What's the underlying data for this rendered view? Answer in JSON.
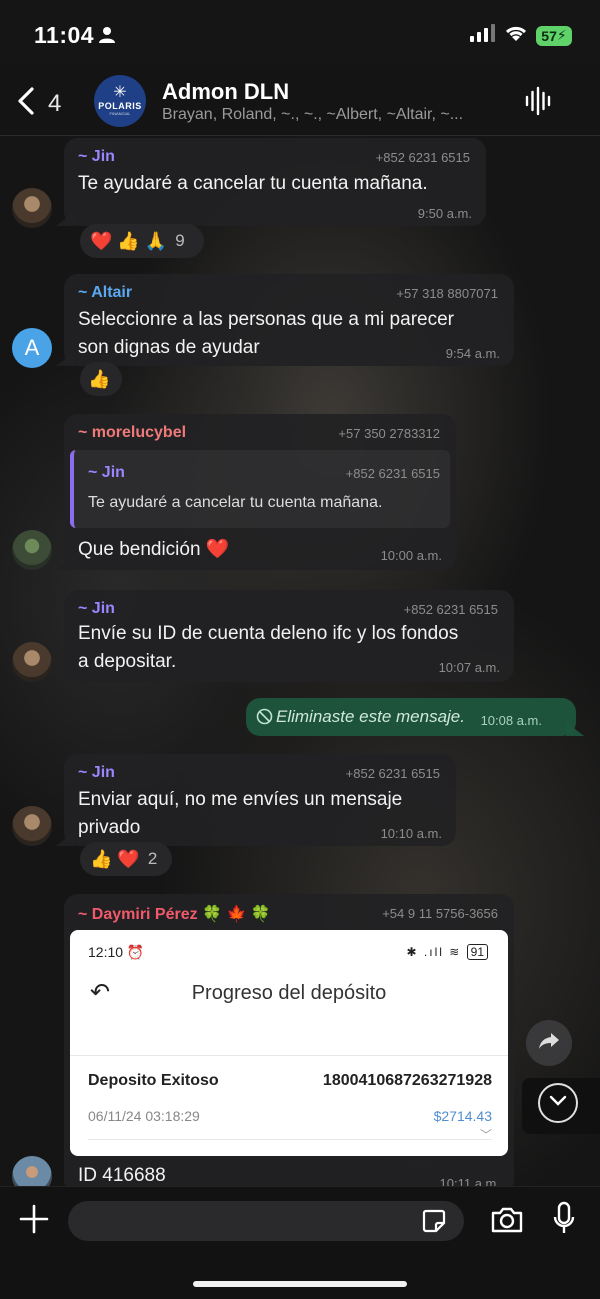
{
  "status": {
    "time": "11:04",
    "battery": "57"
  },
  "header": {
    "back_count": "4",
    "avatar_brand": "POLARIS",
    "avatar_brand_sub": "FINANCIAL",
    "title": "Admon DLN",
    "members": "Brayan, Roland, ~., ~., ~Albert, ~Altair, ~..."
  },
  "messages": [
    {
      "sender": "~ Jin",
      "sender_color": "#9a86ff",
      "phone": "+852 6231 6515",
      "text": "Te ayudaré a cancelar tu cuenta mañana.",
      "time": "9:50 a.m.",
      "reactions": "❤️ 👍 🙏",
      "reaction_count": "9"
    },
    {
      "sender": "~ Altair",
      "sender_color": "#5aa8f0",
      "phone": "+57 318 8807071",
      "text_line1": "Seleccionre a las personas que a mi parecer",
      "text_line2": "son dignas de ayudar",
      "time": "9:54 a.m.",
      "avatar_letter": "A",
      "reactions": "👍"
    },
    {
      "sender": "~ morelucybel",
      "sender_color": "#f07a7a",
      "phone": "+57 350 2783312",
      "quote_sender": "~ Jin",
      "quote_phone": "+852 6231 6515",
      "quote_text": "Te ayudaré a cancelar tu cuenta mañana.",
      "text": "Que bendición ❤️",
      "time": "10:00 a.m."
    },
    {
      "sender": "~ Jin",
      "sender_color": "#9a86ff",
      "phone": "+852 6231 6515",
      "text_line1": "Envíe su ID de cuenta deleno ifc y los fondos",
      "text_line2": "a depositar.",
      "time": "10:07 a.m."
    },
    {
      "own_text": "Eliminaste este mensaje.",
      "time": "10:08 a.m."
    },
    {
      "sender": "~ Jin",
      "sender_color": "#9a86ff",
      "phone": "+852 6231 6515",
      "text_line1": "Enviar aquí, no me envíes un mensaje",
      "text_line2": "privado",
      "time": "10:10 a.m.",
      "reactions": "👍 ❤️",
      "reaction_count": "2"
    },
    {
      "sender": "~ Daymiri Pérez 🍀 🍁 🍀",
      "sender_color": "#f05a6a",
      "phone": "+54 9 11 5756-3656",
      "text": "ID 416688",
      "time": "10:11 a.m."
    }
  ],
  "deposit_screenshot": {
    "time": "12:10",
    "battery": "91",
    "title": "Progreso del depósito",
    "label": "Deposito Exitoso",
    "id": "180041068726327192​8",
    "date": "06/11/24 03:18:29",
    "amount": "$2714.43"
  },
  "icons": [
    "person-icon",
    "signal-icon",
    "wifi-icon",
    "battery-icon",
    "back-chevron-icon",
    "voice-wave-icon",
    "share-icon",
    "scroll-down-icon",
    "add-icon",
    "sticker-icon",
    "camera-icon",
    "mic-icon",
    "block-icon"
  ]
}
